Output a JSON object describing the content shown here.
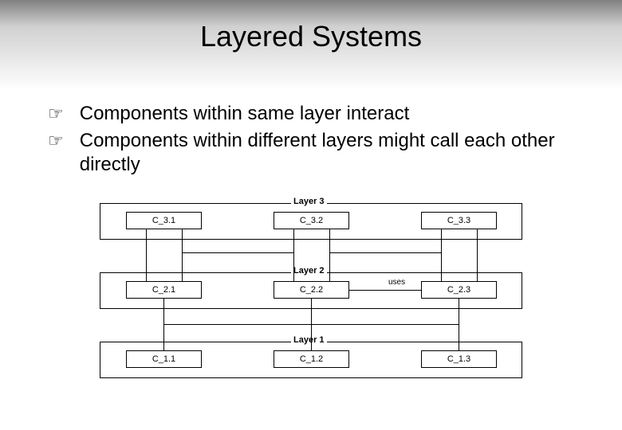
{
  "title": "Layered Systems",
  "bullets": [
    "Components within same layer interact",
    "Components within different layers might call each other directly"
  ],
  "diagram": {
    "layers": [
      {
        "name": "Layer 3",
        "components": [
          "C_3.1",
          "C_3.2",
          "C_3.3"
        ]
      },
      {
        "name": "Layer 2",
        "components": [
          "C_2.1",
          "C_2.2",
          "C_2.3"
        ]
      },
      {
        "name": "Layer 1",
        "components": [
          "C_1.1",
          "C_1.2",
          "C_1.3"
        ]
      }
    ],
    "uses_label": "uses"
  }
}
